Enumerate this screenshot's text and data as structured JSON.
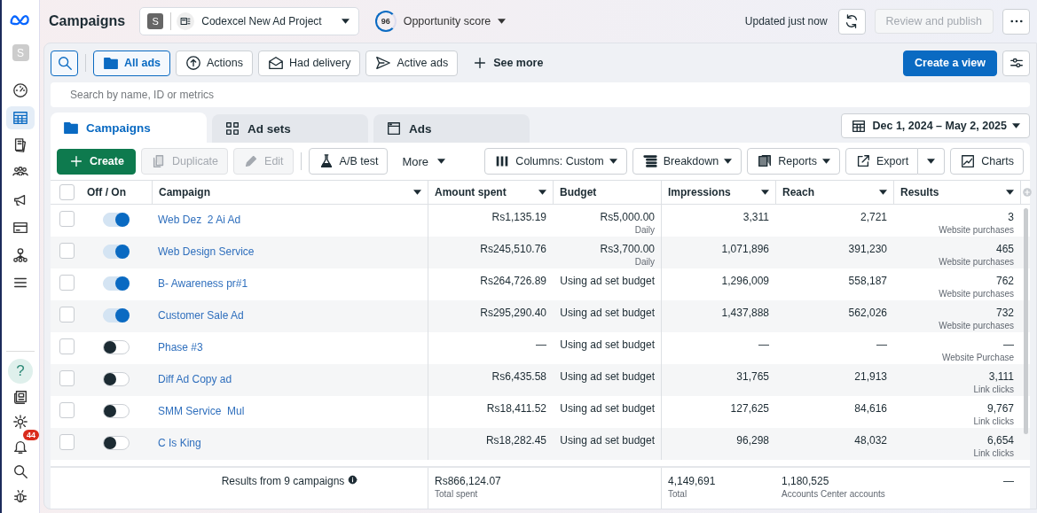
{
  "sidebar": {
    "avatar": "S",
    "items": [
      {
        "selected": false
      },
      {
        "selected": true
      },
      {
        "selected": false
      },
      {
        "selected": false
      },
      {
        "selected": false
      },
      {
        "selected": false
      },
      {
        "selected": false
      },
      {
        "selected": false
      }
    ],
    "help": "?",
    "notification_count": "44"
  },
  "header": {
    "title": "Campaigns",
    "account": {
      "avatar": "S",
      "name": "Codexcel New Ad Project"
    },
    "opportunity": {
      "score": "96",
      "label": "Opportunity score"
    },
    "updated": "Updated just now",
    "review_button": {
      "label": "Review and publish",
      "disabled": true
    }
  },
  "filters": [
    {
      "label": "All ads",
      "selected": true
    },
    {
      "label": "Actions",
      "selected": false
    },
    {
      "label": "Had delivery",
      "selected": false
    },
    {
      "label": "Active ads",
      "selected": false
    }
  ],
  "see_more": "See more",
  "create_view": "Create a view",
  "search": {
    "placeholder": "Search by name, ID or metrics"
  },
  "tabs": [
    {
      "label": "Campaigns",
      "selected": true
    },
    {
      "label": "Ad sets",
      "selected": false
    },
    {
      "label": "Ads",
      "selected": false
    }
  ],
  "date_range": "Dec 1, 2024 – May 2, 2025",
  "toolbar": {
    "left": [
      {
        "label": "Create",
        "kind": "primary"
      },
      {
        "label": "Duplicate",
        "kind": "plain",
        "disabled": true
      },
      {
        "label": "Edit",
        "kind": "plain",
        "disabled": true
      },
      {
        "label": "A/B test",
        "kind": "plain",
        "disabled": false
      },
      {
        "label": "More",
        "kind": "menu"
      }
    ],
    "right": [
      {
        "label": "Columns: Custom",
        "caret": true,
        "split": false
      },
      {
        "label": "Breakdown",
        "caret": true,
        "split": false
      },
      {
        "label": "Reports",
        "caret": true,
        "split": false
      },
      {
        "label": "Export",
        "caret": false,
        "split": true
      },
      {
        "label": "Charts",
        "caret": false,
        "split": false
      }
    ]
  },
  "table": {
    "select_all_checked": false,
    "columns": [
      {
        "label": "Off / On",
        "sortable": false
      },
      {
        "label": "Campaign",
        "sortable": true
      },
      {
        "label": "Amount spent",
        "sortable": true
      },
      {
        "label": "Budget",
        "sortable": false
      },
      {
        "label": "Impressions",
        "sortable": true
      },
      {
        "label": "Reach",
        "sortable": true
      },
      {
        "label": "Results",
        "sortable": true
      }
    ],
    "rows": [
      {
        "checked": false,
        "on": true,
        "name": "Web Dez  2 Ai Ad",
        "amount": "Rs1,135.19",
        "budget": "Rs5,000.00",
        "budget_note": "Daily",
        "impressions": "3,311",
        "reach": "2,721",
        "results": "3",
        "result_type": "Website purchases"
      },
      {
        "checked": false,
        "on": true,
        "name": "Web Design Service",
        "amount": "Rs245,510.76",
        "budget": "Rs3,700.00",
        "budget_note": "Daily",
        "impressions": "1,071,896",
        "reach": "391,230",
        "results": "465",
        "result_type": "Website purchases"
      },
      {
        "checked": false,
        "on": true,
        "name": "B- Awareness pr#1",
        "amount": "Rs264,726.89",
        "budget": "Using ad set budget",
        "impressions": "1,296,009",
        "reach": "558,187",
        "results": "762",
        "result_type": "Website purchases"
      },
      {
        "checked": false,
        "on": true,
        "name": "Customer Sale Ad",
        "amount": "Rs295,290.40",
        "budget": "Using ad set budget",
        "impressions": "1,437,888",
        "reach": "562,026",
        "results": "732",
        "result_type": "Website purchases"
      },
      {
        "checked": false,
        "on": false,
        "name": "Phase #3",
        "amount": "—",
        "budget": "Using ad set budget",
        "impressions": "—",
        "reach": "—",
        "results": "—",
        "result_type": "Website Purchase"
      },
      {
        "checked": false,
        "on": false,
        "name": "Diff Ad Copy ad",
        "amount": "Rs6,435.58",
        "budget": "Using ad set budget",
        "impressions": "31,765",
        "reach": "21,913",
        "results": "3,111",
        "result_type": "Link clicks"
      },
      {
        "checked": false,
        "on": false,
        "name": "SMM Service  Mul",
        "amount": "Rs18,411.52",
        "budget": "Using ad set budget",
        "impressions": "127,625",
        "reach": "84,616",
        "results": "9,767",
        "result_type": "Link clicks"
      },
      {
        "checked": false,
        "on": false,
        "name": "C Is King",
        "amount": "Rs18,282.45",
        "budget": "Using ad set budget",
        "impressions": "96,298",
        "reach": "48,032",
        "results": "6,654",
        "result_type": "Link clicks"
      }
    ],
    "footer": {
      "summary": "Results from 9 campaigns",
      "amount": "Rs866,124.07",
      "amount_note": "Total spent",
      "impressions": "4,149,691",
      "impressions_note": "Total",
      "reach": "1,180,525",
      "reach_note": "Accounts Center accounts",
      "results": "—"
    }
  }
}
